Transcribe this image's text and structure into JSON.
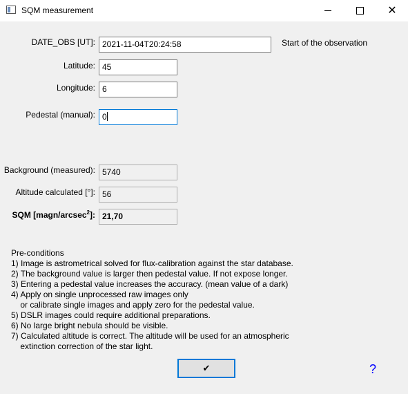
{
  "window": {
    "title": "SQM measurement",
    "minimize_glyph": "",
    "close_glyph": "✕"
  },
  "form": {
    "date_obs_label": "DATE_OBS [UT]:",
    "date_obs_value": "2021-11-04T20:24:58",
    "date_obs_hint": "Start of the observation",
    "latitude_label": "Latitude:",
    "latitude_value": "45",
    "longitude_label": "Longitude:",
    "longitude_value": "6",
    "pedestal_label": "Pedestal (manual):",
    "pedestal_value": "0",
    "background_label": "Background (measured):",
    "background_value": "5740",
    "altitude_label": "Altitude calculated [°]:",
    "altitude_value": "56",
    "sqm_label_main": "SQM [magn/arcsec",
    "sqm_label_sup": "2",
    "sqm_label_end": "]:",
    "sqm_value": "21,70"
  },
  "preconditions": [
    "Pre-conditions",
    "1) Image is astrometrical solved for flux-calibration against the star database.",
    "2) The background value is larger then pedestal value. If not expose longer.",
    "3) Entering a pedestal value increases the accuracy. (mean value of a dark)",
    "4) Apply on single unprocessed raw images only",
    "    or calibrate single images and apply zero for the pedestal value.",
    "5) DSLR images could require additional preparations.",
    "6) No large bright nebula should be visible.",
    "7) Calculated altitude is correct. The altitude will be used for an atmospheric",
    "    extinction correction of the star light."
  ],
  "buttons": {
    "ok_glyph": "✔",
    "help_label": "?"
  },
  "icons": {
    "app": "window-app-icon",
    "ok": "checkmark-icon"
  }
}
